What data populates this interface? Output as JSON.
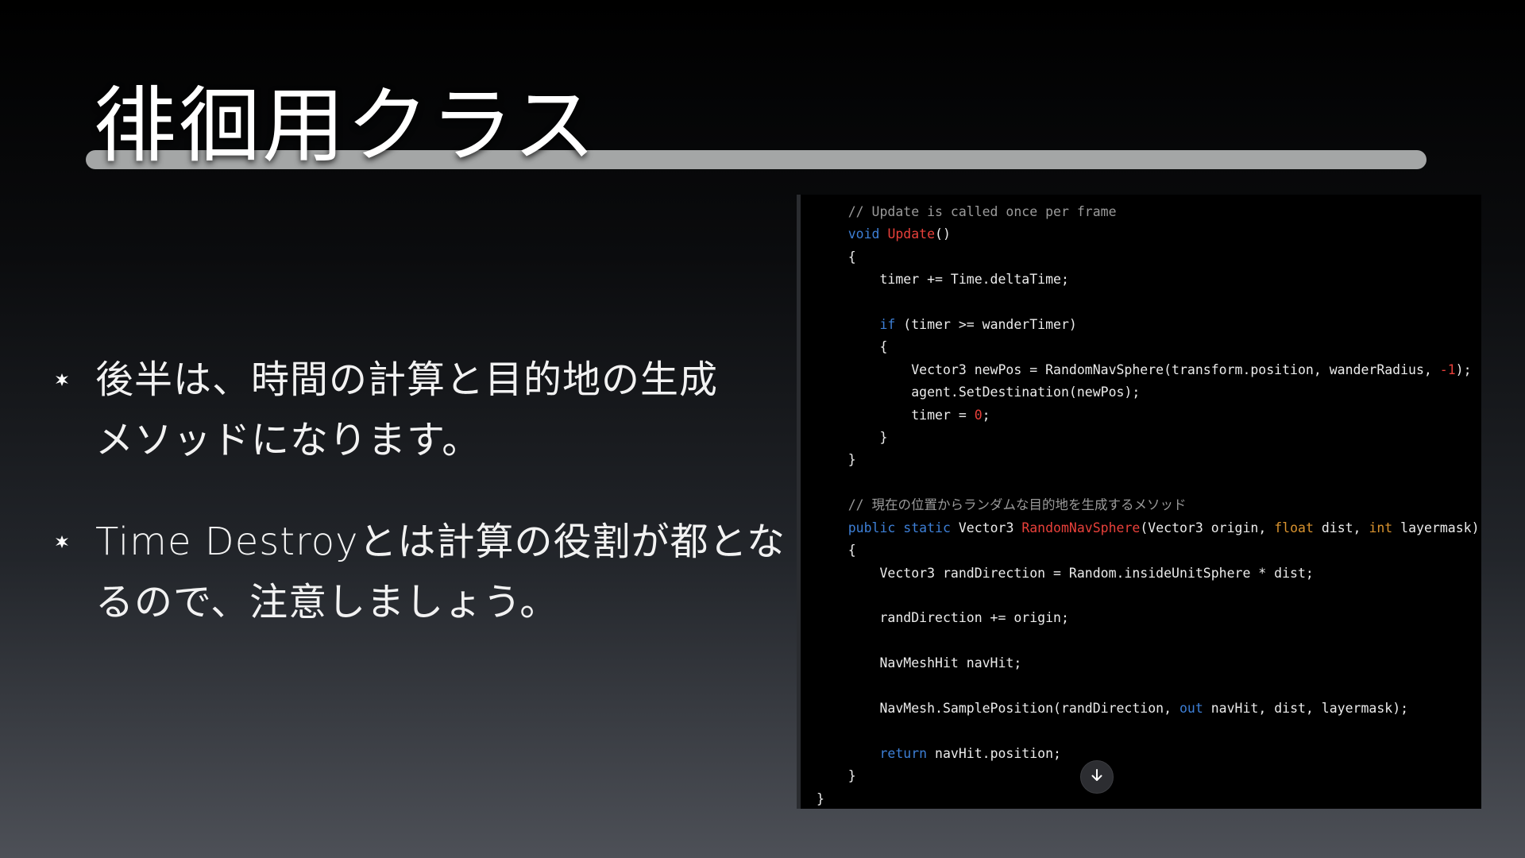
{
  "slide": {
    "title": "徘徊用クラス",
    "bullets": [
      {
        "line1": "後半は、時間の計算と目的地の生成",
        "line2": "メソッドになります。"
      },
      {
        "line1": "Time Destroyとは計算の役割が都とな",
        "line2": "るので、注意しましょう。"
      }
    ]
  },
  "code": {
    "lines": [
      {
        "indent": 1,
        "tokens": [
          {
            "t": "// Update is called once per frame",
            "k": "comment"
          }
        ]
      },
      {
        "indent": 1,
        "tokens": [
          {
            "t": "void",
            "k": "kw"
          },
          {
            "t": " "
          },
          {
            "t": "Update",
            "k": "fn"
          },
          {
            "t": "()"
          }
        ]
      },
      {
        "indent": 1,
        "tokens": [
          {
            "t": "{"
          }
        ]
      },
      {
        "indent": 2,
        "tokens": [
          {
            "t": "timer += Time.deltaTime;"
          }
        ]
      },
      {
        "indent": 0,
        "tokens": []
      },
      {
        "indent": 2,
        "tokens": [
          {
            "t": "if",
            "k": "kw"
          },
          {
            "t": " (timer >= wanderTimer)"
          }
        ]
      },
      {
        "indent": 2,
        "tokens": [
          {
            "t": "{"
          }
        ]
      },
      {
        "indent": 3,
        "tokens": [
          {
            "t": "Vector3 newPos = RandomNavSphere(transform.position, wanderRadius, "
          },
          {
            "t": "-1",
            "k": "num"
          },
          {
            "t": ");"
          }
        ]
      },
      {
        "indent": 3,
        "tokens": [
          {
            "t": "agent.SetDestination(newPos);"
          }
        ]
      },
      {
        "indent": 3,
        "tokens": [
          {
            "t": "timer = "
          },
          {
            "t": "0",
            "k": "num"
          },
          {
            "t": ";"
          }
        ]
      },
      {
        "indent": 2,
        "tokens": [
          {
            "t": "}"
          }
        ]
      },
      {
        "indent": 1,
        "tokens": [
          {
            "t": "}"
          }
        ]
      },
      {
        "indent": 0,
        "tokens": []
      },
      {
        "indent": 1,
        "tokens": [
          {
            "t": "// 現在の位置からランダムな目的地を生成するメソッド",
            "k": "comment"
          }
        ]
      },
      {
        "indent": 1,
        "tokens": [
          {
            "t": "public",
            "k": "kw"
          },
          {
            "t": " "
          },
          {
            "t": "static",
            "k": "kw"
          },
          {
            "t": " Vector3 "
          },
          {
            "t": "RandomNavSphere",
            "k": "fn"
          },
          {
            "t": "(Vector3 origin, "
          },
          {
            "t": "float",
            "k": "type"
          },
          {
            "t": " dist, "
          },
          {
            "t": "int",
            "k": "type"
          },
          {
            "t": " layermask)"
          }
        ]
      },
      {
        "indent": 1,
        "tokens": [
          {
            "t": "{"
          }
        ]
      },
      {
        "indent": 2,
        "tokens": [
          {
            "t": "Vector3 randDirection = Random.insideUnitSphere * dist;"
          }
        ]
      },
      {
        "indent": 0,
        "tokens": []
      },
      {
        "indent": 2,
        "tokens": [
          {
            "t": "randDirection += origin;"
          }
        ]
      },
      {
        "indent": 0,
        "tokens": []
      },
      {
        "indent": 2,
        "tokens": [
          {
            "t": "NavMeshHit navHit;"
          }
        ]
      },
      {
        "indent": 0,
        "tokens": []
      },
      {
        "indent": 2,
        "tokens": [
          {
            "t": "NavMesh.SamplePosition(randDirection, "
          },
          {
            "t": "out",
            "k": "kw"
          },
          {
            "t": " navHit, dist, layermask);"
          }
        ]
      },
      {
        "indent": 0,
        "tokens": []
      },
      {
        "indent": 2,
        "tokens": [
          {
            "t": "return",
            "k": "kw"
          },
          {
            "t": " navHit.position;"
          }
        ]
      },
      {
        "indent": 1,
        "tokens": [
          {
            "t": "}"
          }
        ]
      },
      {
        "indent": 0,
        "tokens": [
          {
            "t": "}"
          }
        ]
      }
    ]
  },
  "icons": {
    "bullet": "bullet-marker-icon",
    "scroll": "arrow-down-icon"
  },
  "colors": {
    "comment": "#9a9a9a",
    "keyword": "#3d7fd6",
    "function": "#e8403a",
    "number": "#e8403a",
    "type": "#d9932f",
    "text": "#ececec",
    "title_bar": "#a4a6a6",
    "code_bg": "#000000"
  }
}
